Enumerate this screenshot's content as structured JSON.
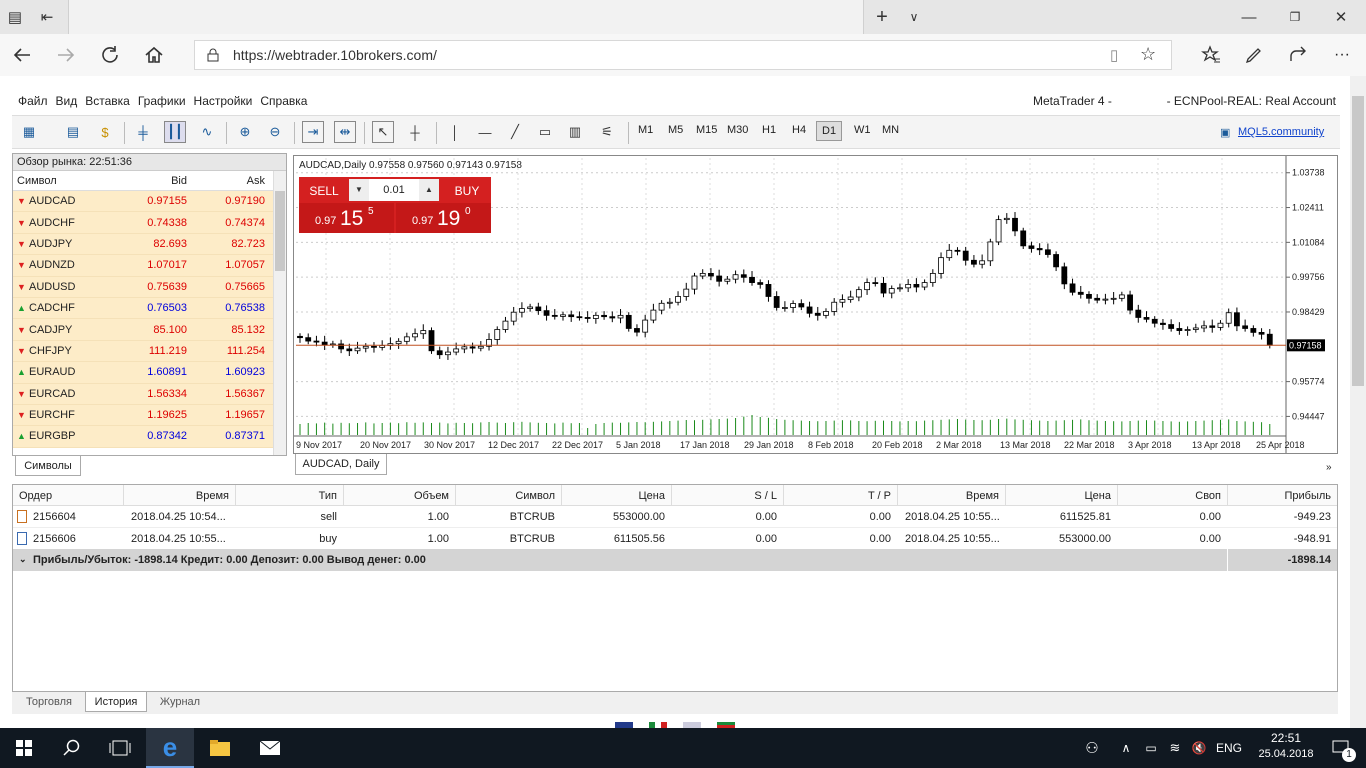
{
  "browser": {
    "url": "https://webtrader.10brokers.com/",
    "new_tab": "+",
    "tab_menu": "∨"
  },
  "app": {
    "menu": [
      "Файл",
      "Вид",
      "Вставка",
      "Графики",
      "Настройки",
      "Справка"
    ],
    "account_prefix": "MetaTrader 4 -",
    "account_suffix": "- ECNPool-REAL: Real Account",
    "mql5": "MQL5.community",
    "timeframes": [
      "M1",
      "M5",
      "M15",
      "M30",
      "H1",
      "H4",
      "D1",
      "W1",
      "MN"
    ],
    "active_timeframe": "D1"
  },
  "market_watch": {
    "title": "Обзор рынка: 22:51:36",
    "col_symbol": "Символ",
    "col_bid": "Bid",
    "col_ask": "Ask",
    "tab": "Символы",
    "rows": [
      {
        "symbol": "AUDCAD",
        "bid": "0.97155",
        "ask": "0.97190",
        "dir": "down"
      },
      {
        "symbol": "AUDCHF",
        "bid": "0.74338",
        "ask": "0.74374",
        "dir": "down"
      },
      {
        "symbol": "AUDJPY",
        "bid": "82.693",
        "ask": "82.723",
        "dir": "down"
      },
      {
        "symbol": "AUDNZD",
        "bid": "1.07017",
        "ask": "1.07057",
        "dir": "down"
      },
      {
        "symbol": "AUDUSD",
        "bid": "0.75639",
        "ask": "0.75665",
        "dir": "down"
      },
      {
        "symbol": "CADCHF",
        "bid": "0.76503",
        "ask": "0.76538",
        "dir": "up"
      },
      {
        "symbol": "CADJPY",
        "bid": "85.100",
        "ask": "85.132",
        "dir": "down"
      },
      {
        "symbol": "CHFJPY",
        "bid": "111.219",
        "ask": "111.254",
        "dir": "down"
      },
      {
        "symbol": "EURAUD",
        "bid": "1.60891",
        "ask": "1.60923",
        "dir": "up"
      },
      {
        "symbol": "EURCAD",
        "bid": "1.56334",
        "ask": "1.56367",
        "dir": "down"
      },
      {
        "symbol": "EURCHF",
        "bid": "1.19625",
        "ask": "1.19657",
        "dir": "down"
      },
      {
        "symbol": "EURGBP",
        "bid": "0.87342",
        "ask": "0.87371",
        "dir": "up"
      }
    ]
  },
  "chart": {
    "header": "AUDCAD,Daily  0.97558 0.97560 0.97143 0.97158",
    "tab": "AUDCAD, Daily",
    "sell_label": "SELL",
    "buy_label": "BUY",
    "lot": "0.01",
    "sell_small": "0.97",
    "sell_big": "15",
    "sell_sup": "5",
    "buy_small": "0.97",
    "buy_big": "19",
    "buy_sup": "0",
    "price_labels": [
      "1.03738",
      "1.02411",
      "1.01084",
      "0.99756",
      "0.98429",
      "0.95774",
      "0.94447"
    ],
    "current_price": "0.97158",
    "date_labels": [
      "9 Nov 2017",
      "20 Nov 2017",
      "30 Nov 2017",
      "12 Dec 2017",
      "22 Dec 2017",
      "5 Jan 2018",
      "17 Jan 2018",
      "29 Jan 2018",
      "8 Feb 2018",
      "20 Feb 2018",
      "2 Mar 2018",
      "13 Mar 2018",
      "22 Mar 2018",
      "3 Apr 2018",
      "13 Apr 2018",
      "25 Apr 2018"
    ]
  },
  "chart_data": {
    "type": "candlestick",
    "title": "AUDCAD,Daily",
    "ylim": [
      0.937,
      1.043
    ],
    "closes": [
      0.9745,
      0.9732,
      0.9728,
      0.9718,
      0.9721,
      0.9702,
      0.9695,
      0.9705,
      0.9712,
      0.9708,
      0.9715,
      0.9722,
      0.9731,
      0.9748,
      0.976,
      0.9772,
      0.9695,
      0.968,
      0.969,
      0.9702,
      0.971,
      0.9705,
      0.9712,
      0.9738,
      0.9776,
      0.9808,
      0.9842,
      0.9856,
      0.9862,
      0.9848,
      0.983,
      0.9826,
      0.9832,
      0.9825,
      0.9822,
      0.9818,
      0.983,
      0.9825,
      0.982,
      0.983,
      0.978,
      0.9766,
      0.9812,
      0.985,
      0.9876,
      0.988,
      0.9902,
      0.993,
      0.998,
      0.999,
      0.998,
      0.996,
      0.9968,
      0.9985,
      0.9975,
      0.9955,
      0.9948,
      0.9902,
      0.986,
      0.986,
      0.9875,
      0.9862,
      0.9838,
      0.983,
      0.9845,
      0.988,
      0.989,
      0.99,
      0.9928,
      0.9955,
      0.9952,
      0.9915,
      0.9932,
      0.9935,
      0.9948,
      0.9938,
      0.9955,
      0.999,
      1.005,
      1.0078,
      1.0075,
      1.004,
      1.0025,
      1.0038,
      1.011,
      1.0195,
      1.02,
      1.0152,
      1.0095,
      1.0085,
      1.008,
      1.0062,
      1.0015,
      0.995,
      0.9918,
      0.991,
      0.9895,
      0.9888,
      0.9892,
      0.9895,
      0.9908,
      0.985,
      0.9822,
      0.9815,
      0.98,
      0.9795,
      0.978,
      0.9772,
      0.9776,
      0.9782,
      0.979,
      0.9784,
      0.98,
      0.984,
      0.979,
      0.978,
      0.9765,
      0.9758,
      0.9716
    ],
    "volumes": [
      0.55,
      0.6,
      0.58,
      0.62,
      0.57,
      0.61,
      0.59,
      0.6,
      0.63,
      0.58,
      0.6,
      0.62,
      0.59,
      0.64,
      0.61,
      0.63,
      0.6,
      0.62,
      0.58,
      0.61,
      0.6,
      0.59,
      0.63,
      0.65,
      0.62,
      0.6,
      0.64,
      0.66,
      0.63,
      0.61,
      0.6,
      0.58,
      0.62,
      0.59,
      0.6,
      0.35,
      0.55,
      0.6,
      0.62,
      0.61,
      0.63,
      0.65,
      0.64,
      0.66,
      0.68,
      0.7,
      0.72,
      0.75,
      0.74,
      0.76,
      0.78,
      0.8,
      0.82,
      0.85,
      0.92,
      1.0,
      0.9,
      0.86,
      0.8,
      0.76,
      0.74,
      0.72,
      0.7,
      0.69,
      0.7,
      0.72,
      0.74,
      0.73,
      0.7,
      0.69,
      0.71,
      0.72,
      0.7,
      0.68,
      0.7,
      0.69,
      0.72,
      0.74,
      0.76,
      0.78,
      0.8,
      0.77,
      0.75,
      0.74,
      0.76,
      0.8,
      0.82,
      0.78,
      0.76,
      0.74,
      0.72,
      0.7,
      0.72,
      0.74,
      0.76,
      0.78,
      0.74,
      0.72,
      0.7,
      0.69,
      0.68,
      0.7,
      0.72,
      0.74,
      0.72,
      0.7,
      0.68,
      0.66,
      0.68,
      0.7,
      0.72,
      0.74,
      0.76,
      0.78,
      0.7,
      0.68,
      0.66,
      0.64,
      0.55
    ]
  },
  "orders": {
    "headers": [
      "Ордер",
      "Время",
      "Тип",
      "Объем",
      "Символ",
      "Цена",
      "S / L",
      "T / P",
      "Время",
      "Цена",
      "Своп",
      "Прибыль"
    ],
    "rows": [
      [
        "2156604",
        "2018.04.25 10:54...",
        "sell",
        "1.00",
        "BTCRUB",
        "553000.00",
        "0.00",
        "0.00",
        "2018.04.25 10:55...",
        "611525.81",
        "0.00",
        "-949.23"
      ],
      [
        "2156606",
        "2018.04.25 10:55...",
        "buy",
        "1.00",
        "BTCRUB",
        "611505.56",
        "0.00",
        "0.00",
        "2018.04.25 10:55...",
        "553000.00",
        "0.00",
        "-948.91"
      ]
    ],
    "summary": "Прибыль/Убыток: -1898.14  Кредит: 0.00  Депозит: 0.00  Вывод денег: 0.00",
    "summary_total": "-1898.14",
    "tabs": [
      "Торговля",
      "История",
      "Журнал"
    ],
    "active_tab": "История"
  },
  "taskbar": {
    "lang": "ENG",
    "time": "22:51",
    "date": "25.04.2018",
    "notify_count": "1"
  },
  "colors": {
    "bid_up": "#0000dd",
    "bid_down": "#dd0000",
    "row_bg": "#fdecc8",
    "buy_sell": "#d42020"
  }
}
